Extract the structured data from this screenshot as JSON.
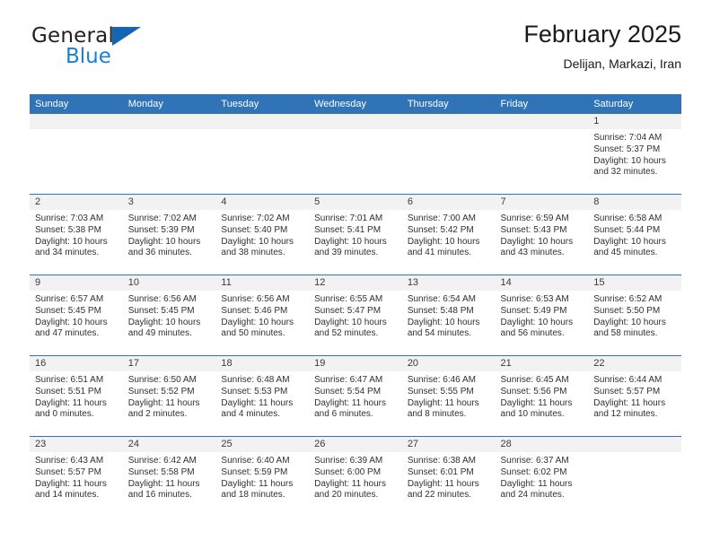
{
  "brand": {
    "line1": "General",
    "line2": "Blue",
    "logo_icon": "triangle-flag-icon"
  },
  "header": {
    "title": "February 2025",
    "subtitle": "Delijan, Markazi, Iran"
  },
  "colors": {
    "header_blue": "#3073b6",
    "brand_blue": "#1b7fd4",
    "daynum_bg": "#f2f2f2",
    "text": "#303030"
  },
  "weekday_headers": [
    "Sunday",
    "Monday",
    "Tuesday",
    "Wednesday",
    "Thursday",
    "Friday",
    "Saturday"
  ],
  "weeks": [
    [
      {
        "day": "",
        "blank": true
      },
      {
        "day": "",
        "blank": true
      },
      {
        "day": "",
        "blank": true
      },
      {
        "day": "",
        "blank": true
      },
      {
        "day": "",
        "blank": true
      },
      {
        "day": "",
        "blank": true
      },
      {
        "day": "1",
        "sunrise": "Sunrise: 7:04 AM",
        "sunset": "Sunset: 5:37 PM",
        "daylight1": "Daylight: 10 hours",
        "daylight2": "and 32 minutes."
      }
    ],
    [
      {
        "day": "2",
        "sunrise": "Sunrise: 7:03 AM",
        "sunset": "Sunset: 5:38 PM",
        "daylight1": "Daylight: 10 hours",
        "daylight2": "and 34 minutes."
      },
      {
        "day": "3",
        "sunrise": "Sunrise: 7:02 AM",
        "sunset": "Sunset: 5:39 PM",
        "daylight1": "Daylight: 10 hours",
        "daylight2": "and 36 minutes."
      },
      {
        "day": "4",
        "sunrise": "Sunrise: 7:02 AM",
        "sunset": "Sunset: 5:40 PM",
        "daylight1": "Daylight: 10 hours",
        "daylight2": "and 38 minutes."
      },
      {
        "day": "5",
        "sunrise": "Sunrise: 7:01 AM",
        "sunset": "Sunset: 5:41 PM",
        "daylight1": "Daylight: 10 hours",
        "daylight2": "and 39 minutes."
      },
      {
        "day": "6",
        "sunrise": "Sunrise: 7:00 AM",
        "sunset": "Sunset: 5:42 PM",
        "daylight1": "Daylight: 10 hours",
        "daylight2": "and 41 minutes."
      },
      {
        "day": "7",
        "sunrise": "Sunrise: 6:59 AM",
        "sunset": "Sunset: 5:43 PM",
        "daylight1": "Daylight: 10 hours",
        "daylight2": "and 43 minutes."
      },
      {
        "day": "8",
        "sunrise": "Sunrise: 6:58 AM",
        "sunset": "Sunset: 5:44 PM",
        "daylight1": "Daylight: 10 hours",
        "daylight2": "and 45 minutes."
      }
    ],
    [
      {
        "day": "9",
        "sunrise": "Sunrise: 6:57 AM",
        "sunset": "Sunset: 5:45 PM",
        "daylight1": "Daylight: 10 hours",
        "daylight2": "and 47 minutes."
      },
      {
        "day": "10",
        "sunrise": "Sunrise: 6:56 AM",
        "sunset": "Sunset: 5:45 PM",
        "daylight1": "Daylight: 10 hours",
        "daylight2": "and 49 minutes."
      },
      {
        "day": "11",
        "sunrise": "Sunrise: 6:56 AM",
        "sunset": "Sunset: 5:46 PM",
        "daylight1": "Daylight: 10 hours",
        "daylight2": "and 50 minutes."
      },
      {
        "day": "12",
        "sunrise": "Sunrise: 6:55 AM",
        "sunset": "Sunset: 5:47 PM",
        "daylight1": "Daylight: 10 hours",
        "daylight2": "and 52 minutes."
      },
      {
        "day": "13",
        "sunrise": "Sunrise: 6:54 AM",
        "sunset": "Sunset: 5:48 PM",
        "daylight1": "Daylight: 10 hours",
        "daylight2": "and 54 minutes."
      },
      {
        "day": "14",
        "sunrise": "Sunrise: 6:53 AM",
        "sunset": "Sunset: 5:49 PM",
        "daylight1": "Daylight: 10 hours",
        "daylight2": "and 56 minutes."
      },
      {
        "day": "15",
        "sunrise": "Sunrise: 6:52 AM",
        "sunset": "Sunset: 5:50 PM",
        "daylight1": "Daylight: 10 hours",
        "daylight2": "and 58 minutes."
      }
    ],
    [
      {
        "day": "16",
        "sunrise": "Sunrise: 6:51 AM",
        "sunset": "Sunset: 5:51 PM",
        "daylight1": "Daylight: 11 hours",
        "daylight2": "and 0 minutes."
      },
      {
        "day": "17",
        "sunrise": "Sunrise: 6:50 AM",
        "sunset": "Sunset: 5:52 PM",
        "daylight1": "Daylight: 11 hours",
        "daylight2": "and 2 minutes."
      },
      {
        "day": "18",
        "sunrise": "Sunrise: 6:48 AM",
        "sunset": "Sunset: 5:53 PM",
        "daylight1": "Daylight: 11 hours",
        "daylight2": "and 4 minutes."
      },
      {
        "day": "19",
        "sunrise": "Sunrise: 6:47 AM",
        "sunset": "Sunset: 5:54 PM",
        "daylight1": "Daylight: 11 hours",
        "daylight2": "and 6 minutes."
      },
      {
        "day": "20",
        "sunrise": "Sunrise: 6:46 AM",
        "sunset": "Sunset: 5:55 PM",
        "daylight1": "Daylight: 11 hours",
        "daylight2": "and 8 minutes."
      },
      {
        "day": "21",
        "sunrise": "Sunrise: 6:45 AM",
        "sunset": "Sunset: 5:56 PM",
        "daylight1": "Daylight: 11 hours",
        "daylight2": "and 10 minutes."
      },
      {
        "day": "22",
        "sunrise": "Sunrise: 6:44 AM",
        "sunset": "Sunset: 5:57 PM",
        "daylight1": "Daylight: 11 hours",
        "daylight2": "and 12 minutes."
      }
    ],
    [
      {
        "day": "23",
        "sunrise": "Sunrise: 6:43 AM",
        "sunset": "Sunset: 5:57 PM",
        "daylight1": "Daylight: 11 hours",
        "daylight2": "and 14 minutes."
      },
      {
        "day": "24",
        "sunrise": "Sunrise: 6:42 AM",
        "sunset": "Sunset: 5:58 PM",
        "daylight1": "Daylight: 11 hours",
        "daylight2": "and 16 minutes."
      },
      {
        "day": "25",
        "sunrise": "Sunrise: 6:40 AM",
        "sunset": "Sunset: 5:59 PM",
        "daylight1": "Daylight: 11 hours",
        "daylight2": "and 18 minutes."
      },
      {
        "day": "26",
        "sunrise": "Sunrise: 6:39 AM",
        "sunset": "Sunset: 6:00 PM",
        "daylight1": "Daylight: 11 hours",
        "daylight2": "and 20 minutes."
      },
      {
        "day": "27",
        "sunrise": "Sunrise: 6:38 AM",
        "sunset": "Sunset: 6:01 PM",
        "daylight1": "Daylight: 11 hours",
        "daylight2": "and 22 minutes."
      },
      {
        "day": "28",
        "sunrise": "Sunrise: 6:37 AM",
        "sunset": "Sunset: 6:02 PM",
        "daylight1": "Daylight: 11 hours",
        "daylight2": "and 24 minutes."
      },
      {
        "day": "",
        "blank": true
      }
    ]
  ]
}
